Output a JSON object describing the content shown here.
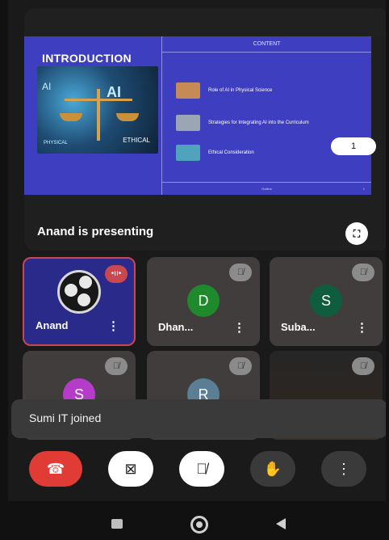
{
  "presentation": {
    "slide": {
      "title": "INTRODUCTION",
      "content_header": "CONTENT",
      "items": [
        "Role of AI in Physical Science",
        "Strategies for Integrating AI into the Curriculum",
        "Ethical Consideration"
      ],
      "image_text_ai_left": "AI",
      "image_text_ai_right": "AI",
      "image_text_physical": "PHYSICAL",
      "image_text_ethical": "ETHICAL",
      "footer": "Outline",
      "footer_page": "1"
    },
    "page_indicator": "1",
    "presenting_label": "Anand is presenting"
  },
  "participants": [
    {
      "name": "Anand",
      "avatar": "obs-logo",
      "state": "speaking"
    },
    {
      "name": "Dhan...",
      "initial": "D",
      "color": "#1f8a2b",
      "state": "muted"
    },
    {
      "name": "Suba...",
      "initial": "S",
      "color": "#0f5c3f",
      "state": "muted"
    },
    {
      "initial": "S",
      "color": "#b53cc8",
      "state": "muted"
    },
    {
      "initial": "R",
      "color": "#5a7e94",
      "state": "muted"
    },
    {
      "state": "muted",
      "video": true
    }
  ],
  "toast": {
    "text": "Sumi IT joined"
  },
  "controls": {
    "end_call_icon": "phone-hangup-icon",
    "camera_icon": "camera-off-icon",
    "mic_icon": "mic-off-icon",
    "hand_icon": "raise-hand-icon",
    "more_icon": "more-vertical-icon",
    "more_glyph": "⋮"
  },
  "colors": {
    "end_call": "#e13b36",
    "slide_bg": "#3e3fc0",
    "speaking": "#c9474f"
  }
}
